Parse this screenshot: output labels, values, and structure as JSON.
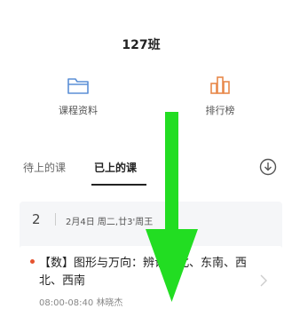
{
  "header": {
    "title": "127班"
  },
  "nav": [
    {
      "label": "课程资料",
      "icon": "folder-icon",
      "color": "#5b8fd6"
    },
    {
      "label": "排行榜",
      "icon": "bar-chart-icon",
      "color": "#e8884a"
    }
  ],
  "tabs": {
    "upcoming": "待上的课",
    "done": "已上的课",
    "active": "done"
  },
  "download_icon": "download-circle-icon",
  "week": {
    "number": "2",
    "dates": "2月4日 周二,廿3'周王"
  },
  "lesson": {
    "title": "【数】图形与万向：辨识东北、东南、西北、西南",
    "time": "08:00-08:40",
    "teacher": "林晓杰",
    "dot_color": "#e5532f"
  },
  "overlay": {
    "icon": "green-down-arrow-icon",
    "color": "#22dd22"
  }
}
